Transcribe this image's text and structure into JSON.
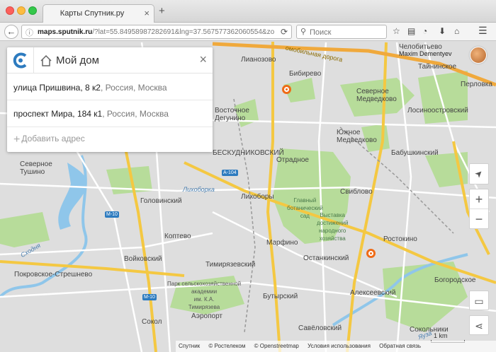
{
  "browser": {
    "tab_title": "Карты Спутник.ру",
    "tab_close": "×",
    "new_tab": "+",
    "url_domain": "maps.sputnik.ru",
    "url_path": "/?lat=55.84958987282691&lng=37.567577362060554&zo",
    "search_placeholder": "Поиск",
    "icons": [
      "back-arrow-icon",
      "info-icon",
      "reload-icon",
      "search-icon",
      "star-icon",
      "reading-list-icon",
      "rss-icon",
      "download-icon",
      "home-icon",
      "menu-icon"
    ]
  },
  "panel": {
    "title": "Мой дом",
    "close": "×",
    "addresses": [
      {
        "main": "улица Пришвина, 8 к2",
        "rest": ", Россия, Москва"
      },
      {
        "main": "проспект Мира, 184 к1",
        "rest": ", Россия, Москва"
      }
    ],
    "add_label": "Добавить адрес",
    "add_plus": "+"
  },
  "user": {
    "name": "Maxim Dementyev"
  },
  "map": {
    "districts": {
      "lianozovo": "Лианозово",
      "bibirevo": "Бибирево",
      "chelobitevo": "Челобитьево",
      "taininskoe": "Тайнинское",
      "perlovka": "Перловка",
      "sev_medvedkovo": "Северное\nМедведково",
      "losinoostrovsky": "Лосиноостровский",
      "vostochnoe_degunino": "Восточное\nДегунино",
      "yuzh_medvedkovo": "Южное\nМедведково",
      "babushkinsky": "Бабушкинский",
      "dmitrovsky_partial": "ВСКИЙ",
      "beskudnikovsky": "БЕСКУДНИКОВСКИЙ",
      "otradnoe": "Отрадное",
      "sev_tushino": "Северное\nТушино",
      "sviblovo": "Свиблово",
      "likhobory": "Лихоборы",
      "golovinsky": "Головинский",
      "koptevo": "Коптево",
      "marfino": "Марфино",
      "rostokino": "Ростокино",
      "ostankinsky": "Останкинский",
      "voykovsky": "Войковский",
      "timiryazevsky": "Тимирязевский",
      "pokrovskoe_streshnevo": "Покровское-Стрешнево",
      "alekseevsky": "Алексеевский",
      "bogorodskoe": "Богородское",
      "butyrsky": "Бутырский",
      "sokol": "Сокол",
      "aeroport": "Аэропорт",
      "sokolniki": "Сокольники",
      "savelovsky": "Савёловский"
    },
    "parks": {
      "botanical": "Главный\nботанический\nсад",
      "vdnh": "Выставка\nдостижений\nнародного\nхозяйства",
      "timiryazev": "Парк сельскохозяйственной\nакадемии\nим. К.А.\nТимирязева"
    },
    "roads": {
      "mkad": "омобильная дорога",
      "likhoborka": "Лихоборка",
      "skhodnya": "Сходня",
      "yauza": "Яуза"
    },
    "shields": {
      "a104": "A-104",
      "m10a": "M-10",
      "m10b": "M-10"
    },
    "scale": "1 km"
  },
  "attribution": {
    "sputnik": "Спутник",
    "rostelecom": "© Ростелеком",
    "osm": "© Openstreetmap",
    "terms": "Условия использования",
    "feedback": "Обратная связь"
  },
  "controls": {
    "locate": "➤",
    "zoom_in": "+",
    "zoom_out": "−",
    "ruler": "▭",
    "share": "⋖"
  },
  "colors": {
    "accent": "#2d7bbf",
    "poi": "#ef6b17",
    "park": "#b7dc9a",
    "major_road": "#f4c842",
    "mkad": "#f0a93c"
  }
}
